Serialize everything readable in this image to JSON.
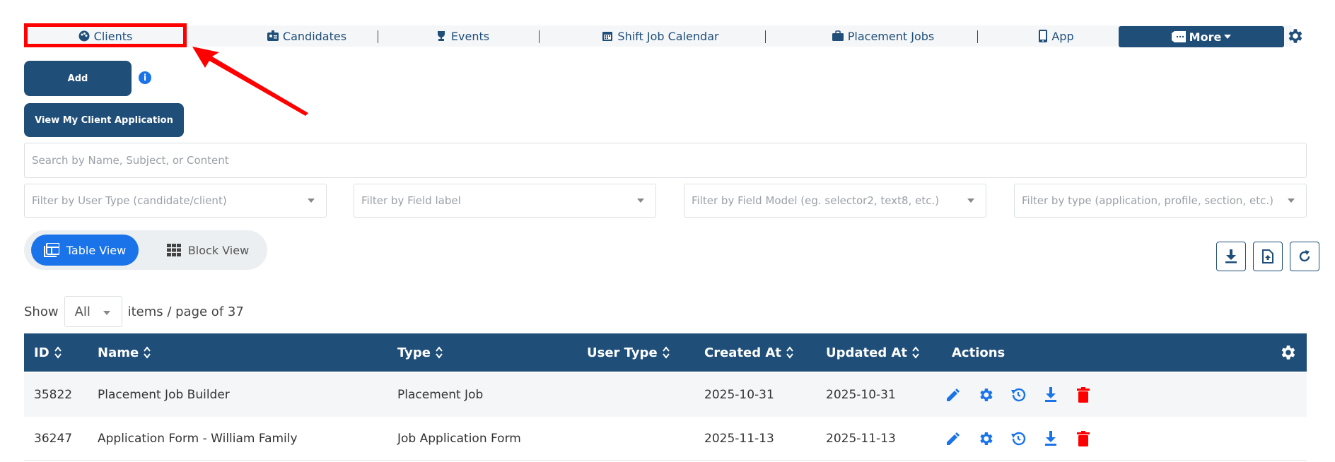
{
  "nav": {
    "items": [
      {
        "label": "Clients",
        "icon": "palette-icon"
      },
      {
        "label": "Candidates",
        "icon": "id-badge-icon"
      },
      {
        "label": "Events",
        "icon": "trophy-icon"
      },
      {
        "label": "Shift Job Calendar",
        "icon": "calendar-icon"
      },
      {
        "label": "Placement Jobs",
        "icon": "briefcase-icon"
      },
      {
        "label": "App",
        "icon": "mobile-icon"
      }
    ],
    "more_label": "More",
    "highlight_color": "#ff0000"
  },
  "buttons": {
    "add_label": "Add",
    "view_app_label": "View My Client Application"
  },
  "search": {
    "placeholder": "Search by Name, Subject, or Content"
  },
  "filters": [
    "Filter by User Type (candidate/client)",
    "Filter by Field label",
    "Filter by Field Model (eg. selector2, text8, etc.)",
    "Filter by type (application, profile, section, etc.)"
  ],
  "view_toggle": {
    "table": "Table View",
    "block": "Block View"
  },
  "pagination": {
    "show_label": "Show",
    "page_size": "All",
    "suffix": "items / page of 37"
  },
  "table": {
    "columns": [
      "ID",
      "Name",
      "Type",
      "User Type",
      "Created At",
      "Updated At",
      "Actions"
    ],
    "rows": [
      {
        "id": "35822",
        "name": "Placement Job Builder",
        "type": "Placement Job",
        "user_type": "",
        "created": "2025-10-31",
        "updated": "2025-10-31"
      },
      {
        "id": "36247",
        "name": "Application Form - William Family",
        "type": "Job Application Form",
        "user_type": "",
        "created": "2025-11-13",
        "updated": "2025-11-13"
      }
    ]
  },
  "colors": {
    "primary": "#1f4e79",
    "accent": "#1a73e8",
    "danger": "#ff0000"
  }
}
